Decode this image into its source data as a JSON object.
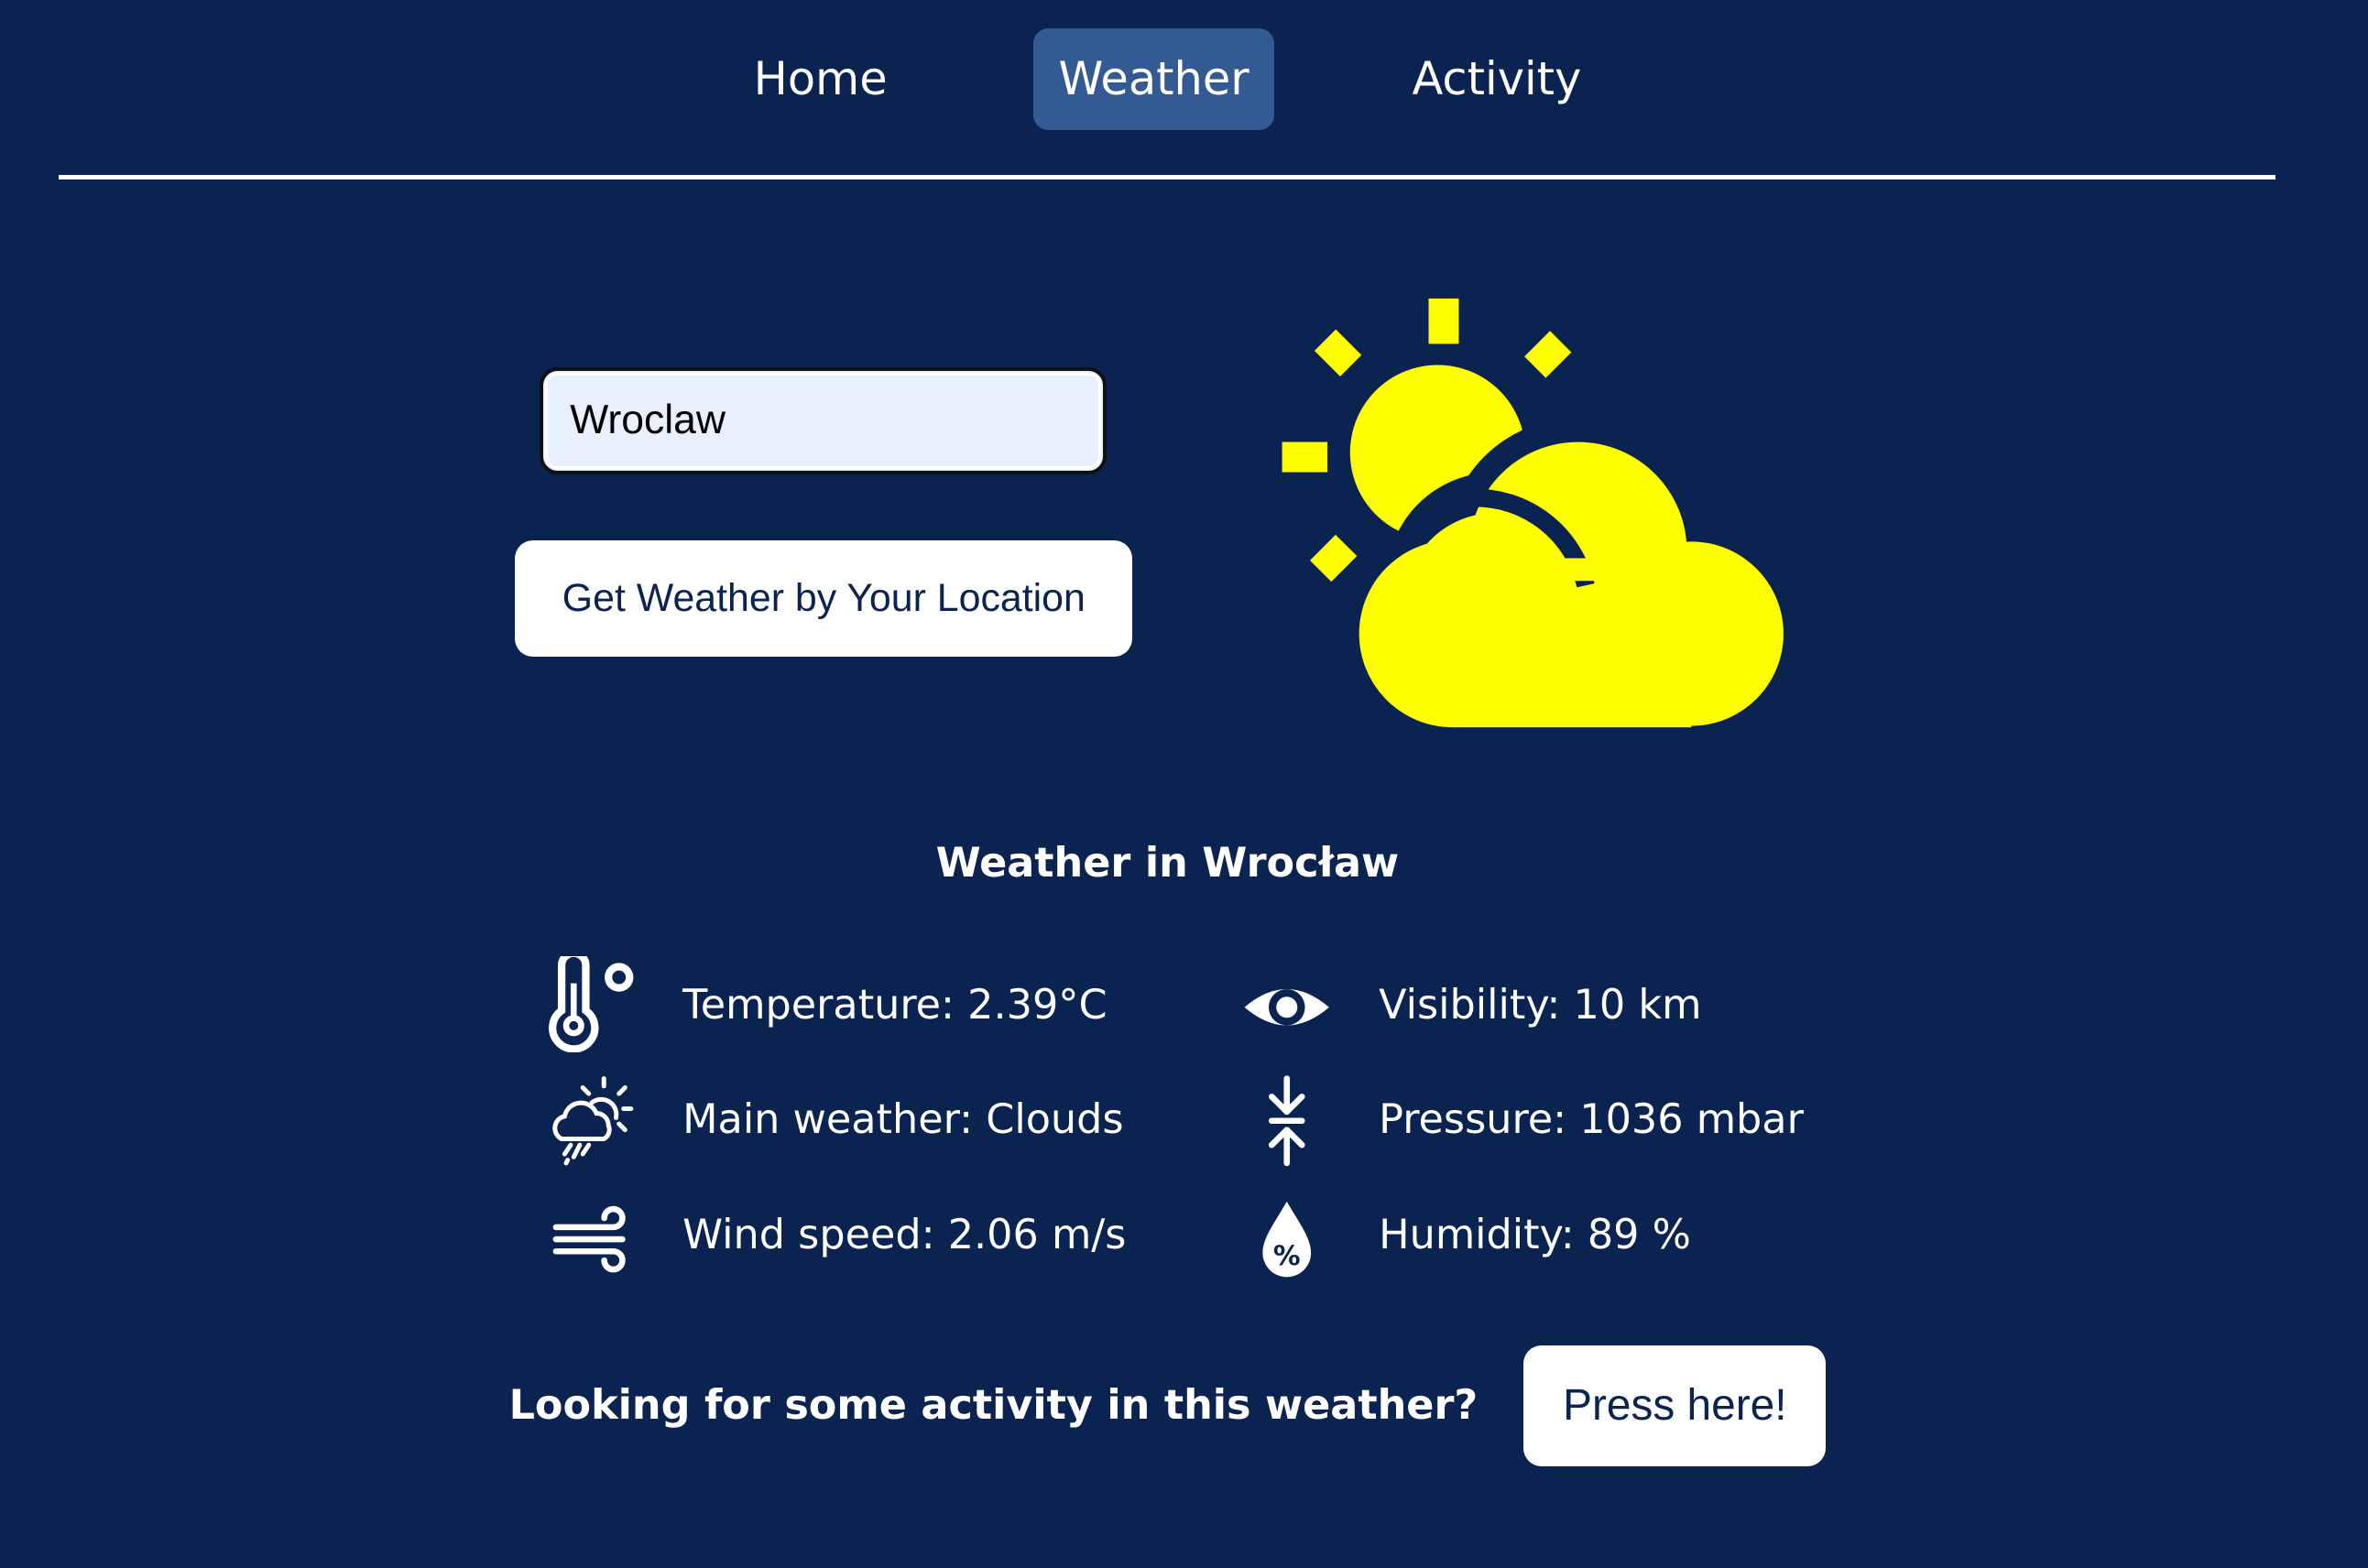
{
  "nav": {
    "home": "Home",
    "weather": "Weather",
    "activity": "Activity",
    "active": "Weather"
  },
  "search": {
    "value": "Wroclaw"
  },
  "location_button": "Get Weather by Your Location",
  "hero_icon": {
    "name": "partly-cloudy-icon",
    "color": "#ffff00"
  },
  "weather": {
    "title": "Weather in Wrocław",
    "temperature": "Temperature: 2.39°C",
    "main": "Main weather: Clouds",
    "wind": "Wind speed: 2.06 m/s",
    "visibility": "Visibility: 10 km",
    "pressure": "Pressure: 1036 mbar",
    "humidity": "Humidity: 89 %"
  },
  "cta": {
    "text": "Looking for some activity in this weather?",
    "button": "Press here!"
  },
  "colors": {
    "background": "#0a2350",
    "nav_active": "#345a94",
    "accent": "#ffff00",
    "text": "#ffffff"
  }
}
